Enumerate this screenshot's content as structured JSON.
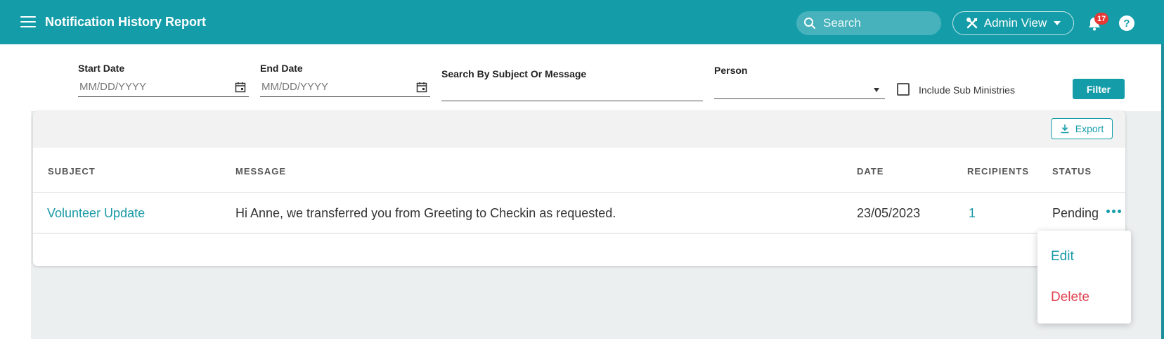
{
  "header": {
    "title": "Notification History Report",
    "search_placeholder": "Search",
    "view_label": "Admin View",
    "notification_count": "17",
    "help_label": "?"
  },
  "filters": {
    "start_date_label": "Start Date",
    "start_date_placeholder": "MM/DD/YYYY",
    "end_date_label": "End Date",
    "end_date_placeholder": "MM/DD/YYYY",
    "search_label": "Search By Subject Or Message",
    "person_label": "Person",
    "include_sub_label": "Include Sub Ministries",
    "filter_button": "Filter"
  },
  "toolbar": {
    "export_label": "Export"
  },
  "table": {
    "columns": [
      "SUBJECT",
      "MESSAGE",
      "DATE",
      "RECIPIENTS",
      "STATUS"
    ],
    "rows": [
      {
        "subject": "Volunteer Update",
        "message": "Hi Anne, we transferred you from Greeting to Checkin as requested.",
        "date": "23/05/2023",
        "recipients": "1",
        "status": "Pending"
      }
    ]
  },
  "context_menu": {
    "edit": "Edit",
    "delete": "Delete"
  },
  "colors": {
    "brand": "#149da9",
    "danger": "#e0424f"
  }
}
